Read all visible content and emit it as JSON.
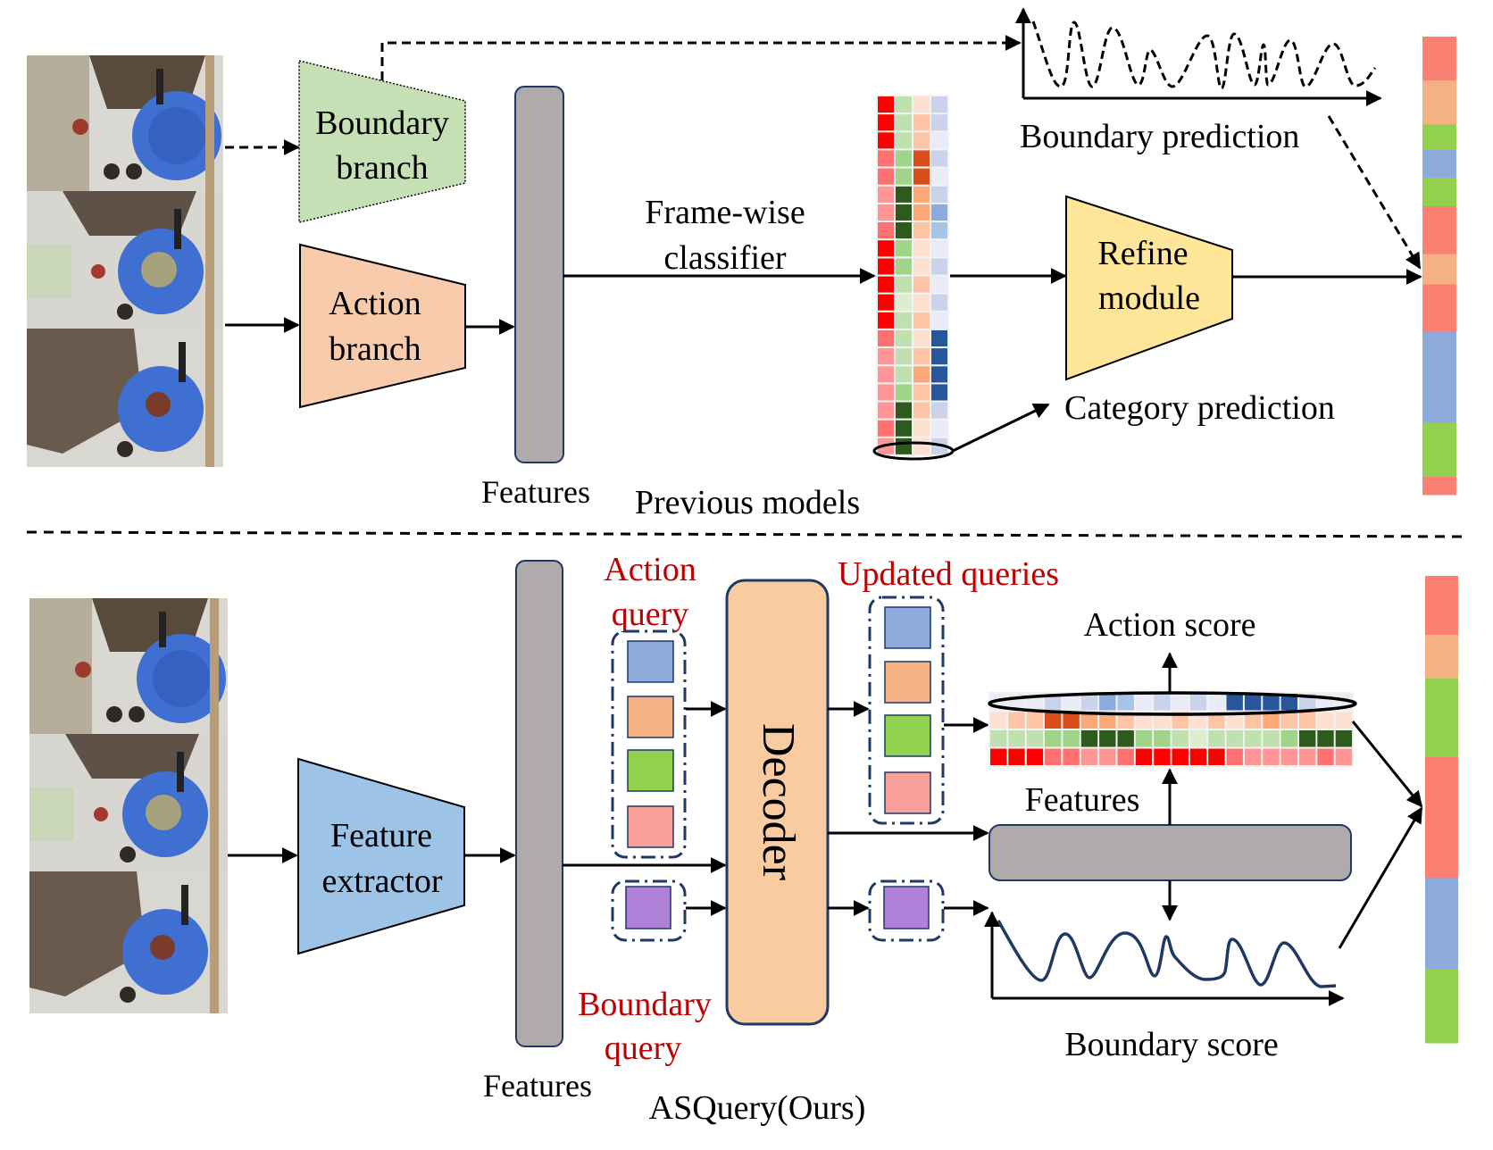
{
  "figure": {
    "top_section": {
      "caption": "Previous models",
      "boundary_branch": {
        "line1": "Boundary",
        "line2": "branch"
      },
      "action_branch": {
        "line1": "Action",
        "line2": "branch"
      },
      "features_label": "Features",
      "classifier_label": {
        "line1": "Frame-wise",
        "line2": "classifier"
      },
      "refine_module": {
        "line1": "Refine",
        "line2": "module"
      },
      "boundary_prediction_label": "Boundary prediction",
      "category_prediction_label": "Category prediction",
      "heatmap": {
        "rows": [
          [
            "#ff0000",
            "#c0e0b0",
            "#fee0d2",
            "#cbd3ec"
          ],
          [
            "#ff0000",
            "#c0e0b0",
            "#fdc5a5",
            "#cbd3ec"
          ],
          [
            "#ff0000",
            "#c0e0b0",
            "#fdc5a5",
            "#e9ecf6"
          ],
          [
            "#ff7070",
            "#a0d488",
            "#d94d1a",
            "#cbd3ec"
          ],
          [
            "#ff7070",
            "#a0d488",
            "#d94d1a",
            "#e9ecf6"
          ],
          [
            "#ff9595",
            "#2e5a1e",
            "#fda878",
            "#cbd3ec"
          ],
          [
            "#ff9595",
            "#2e5a1e",
            "#fda878",
            "#8aabdc"
          ],
          [
            "#ff7070",
            "#2e5a1e",
            "#fdc5a5",
            "#a8c3e8"
          ],
          [
            "#ff0000",
            "#a0d488",
            "#fee0d2",
            "#e9ecf6"
          ],
          [
            "#ff0000",
            "#a0d488",
            "#fee0d2",
            "#cbd3ec"
          ],
          [
            "#ff0000",
            "#c0e0b0",
            "#fdc5a5",
            "#e9ecf6"
          ],
          [
            "#ff0000",
            "#dbeed0",
            "#fee0d2",
            "#cbd3ec"
          ],
          [
            "#ff0000",
            "#c0e0b0",
            "#fdc5a5",
            "#e9ecf6"
          ],
          [
            "#ff7070",
            "#c0e0b0",
            "#fee0d2",
            "#27579a"
          ],
          [
            "#ff9595",
            "#c0e0b0",
            "#fdc5a5",
            "#27579a"
          ],
          [
            "#ff9595",
            "#c0e0b0",
            "#fda878",
            "#27579a"
          ],
          [
            "#ff9595",
            "#a0d488",
            "#fdc5a5",
            "#27579a"
          ],
          [
            "#ff9595",
            "#2e5a1e",
            "#fdc5a5",
            "#cbd3ec"
          ],
          [
            "#ff7070",
            "#2e5a1e",
            "#fee0d2",
            "#e9ecf6"
          ],
          [
            "#ff9595",
            "#2e5a1e",
            "#fee0d2",
            "#cbd3ec"
          ]
        ]
      },
      "segmentation_bar": [
        {
          "label": "red",
          "color": "#fa8072",
          "fraction": 0.096
        },
        {
          "label": "orange",
          "color": "#f4b183",
          "fraction": 0.096
        },
        {
          "label": "green",
          "color": "#92d050",
          "fraction": 0.055
        },
        {
          "label": "blue",
          "color": "#8faadc",
          "fraction": 0.061
        },
        {
          "label": "green",
          "color": "#92d050",
          "fraction": 0.063
        },
        {
          "label": "red",
          "color": "#fa8072",
          "fraction": 0.104
        },
        {
          "label": "orange",
          "color": "#f4b183",
          "fraction": 0.066
        },
        {
          "label": "red",
          "color": "#fa8072",
          "fraction": 0.104
        },
        {
          "label": "blue",
          "color": "#8faadc",
          "fraction": 0.197
        },
        {
          "label": "green",
          "color": "#92d050",
          "fraction": 0.119
        },
        {
          "label": "red",
          "color": "#fa8072",
          "fraction": 0.039
        }
      ]
    },
    "bottom_section": {
      "caption": "ASQuery(Ours)",
      "feature_extractor": {
        "line1": "Feature",
        "line2": "extractor"
      },
      "features_label": "Features",
      "action_query_label": {
        "line1": "Action",
        "line2": "query"
      },
      "boundary_query_label": {
        "line1": "Boundary",
        "line2": "query"
      },
      "decoder_label": "Decoder",
      "updated_queries_label": "Updated queries",
      "action_score_label": "Action score",
      "features_label_right": "Features",
      "boundary_score_label": "Boundary score",
      "action_query_colors": [
        "#8faadc",
        "#f4b183",
        "#92d050",
        "#f8a19a"
      ],
      "boundary_query_color": "#b07fd8",
      "heatmap": {
        "rows": [
          [
            "#e9ecf6",
            "#e9ecf6",
            "#e9ecf6",
            "#cbd3ec",
            "#e9ecf6",
            "#cbd3ec",
            "#8aabdc",
            "#a8c3e8",
            "#e9ecf6",
            "#cbd3ec",
            "#e9ecf6",
            "#cbd3ec",
            "#e9ecf6",
            "#27579a",
            "#27579a",
            "#27579a",
            "#27579a",
            "#cbd3ec",
            "#e9ecf6",
            "#e9ecf6"
          ],
          [
            "#fee0d2",
            "#fdc5a5",
            "#fdc5a5",
            "#d94d1a",
            "#d94d1a",
            "#fda878",
            "#fda878",
            "#fdc5a5",
            "#fee0d2",
            "#fee0d2",
            "#fdc5a5",
            "#fee0d2",
            "#fdc5a5",
            "#fee0d2",
            "#fdc5a5",
            "#fda878",
            "#fdc5a5",
            "#fdc5a5",
            "#fee0d2",
            "#fee0d2"
          ],
          [
            "#c0e0b0",
            "#c0e0b0",
            "#c0e0b0",
            "#a0d488",
            "#a0d488",
            "#2e5a1e",
            "#2e5a1e",
            "#2e5a1e",
            "#a0d488",
            "#a0d488",
            "#c0e0b0",
            "#dbeed0",
            "#c0e0b0",
            "#c0e0b0",
            "#c0e0b0",
            "#c0e0b0",
            "#a0d488",
            "#2e5a1e",
            "#2e5a1e",
            "#2e5a1e"
          ],
          [
            "#ff0000",
            "#ff0000",
            "#ff0000",
            "#ff7070",
            "#ff7070",
            "#ff9595",
            "#ff9595",
            "#ff7070",
            "#ff0000",
            "#ff0000",
            "#ff0000",
            "#ff0000",
            "#ff0000",
            "#ff7070",
            "#ff9595",
            "#ff9595",
            "#ff9595",
            "#ff9595",
            "#ff7070",
            "#ff9595"
          ]
        ]
      },
      "segmentation_bar": [
        {
          "label": "red",
          "color": "#fa8072",
          "fraction": 0.126
        },
        {
          "label": "orange",
          "color": "#f4b183",
          "fraction": 0.094
        },
        {
          "label": "green",
          "color": "#92d050",
          "fraction": 0.168
        },
        {
          "label": "red",
          "color": "#fa8072",
          "fraction": 0.258
        },
        {
          "label": "blue",
          "color": "#8faadc",
          "fraction": 0.197
        },
        {
          "label": "green",
          "color": "#92d050",
          "fraction": 0.157
        }
      ]
    },
    "colors": {
      "boundary_branch_fill": "#c5e0b4",
      "action_branch_fill": "#f8cbad",
      "refine_module_fill": "#ffe699",
      "feature_extractor_fill": "#9dc3e6",
      "features_bar_fill": "#afabab",
      "decoder_fill": "#f8cba0",
      "border_navy": "#203864",
      "label_red": "#c00000",
      "curve_navy": "#203864"
    }
  }
}
